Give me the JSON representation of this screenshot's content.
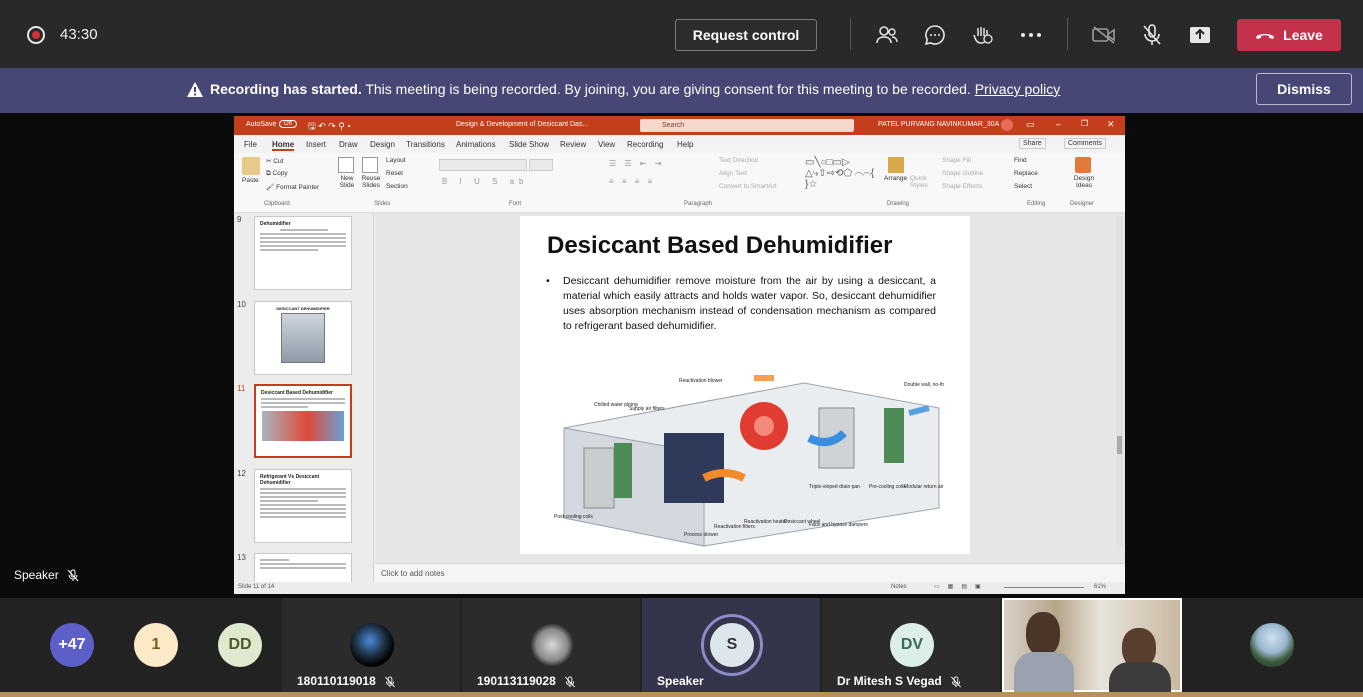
{
  "topbar": {
    "timer": "43:30",
    "request_control": "Request control",
    "leave": "Leave"
  },
  "banner": {
    "bold": "Recording has started.",
    "text": " This meeting is being recorded. By joining, you are giving consent for this meeting to be recorded. ",
    "link": "Privacy policy",
    "dismiss": "Dismiss"
  },
  "ppt": {
    "autosave": "AutoSave",
    "autosave_state": "Off",
    "doc_title": "Design & Development of Desiccant  Das...",
    "search": "Search",
    "user": "PATEL PURVANG NAVINKUMAR_30A",
    "tabs": [
      "File",
      "Home",
      "Insert",
      "Draw",
      "Design",
      "Transitions",
      "Animations",
      "Slide Show",
      "Review",
      "View",
      "Recording",
      "Help"
    ],
    "share": "Share",
    "comments": "Comments",
    "ribbon": {
      "paste": "Paste",
      "cut": "Cut",
      "copy": "Copy",
      "format_painter": "Format Painter",
      "new_slide": "New Slide",
      "reuse_slides": "Reuse Slides",
      "layout": "Layout",
      "reset": "Reset",
      "section": "Section",
      "text_direction": "Text Direction",
      "align_text": "Align Text",
      "convert_smartart": "Convert to SmartArt",
      "arrange": "Arrange",
      "quick_styles": "Quick Styles",
      "shape_fill": "Shape Fill",
      "shape_outline": "Shape Outline",
      "shape_effects": "Shape Effects",
      "find": "Find",
      "replace": "Replace",
      "select": "Select",
      "design_ideas": "Design Ideas",
      "groups": [
        "Clipboard",
        "Slides",
        "Font",
        "Paragraph",
        "Drawing",
        "Editing",
        "Designer"
      ]
    },
    "thumbs": [
      {
        "num": "9",
        "title": "Dehumidifier"
      },
      {
        "num": "10",
        "title": "DESICCANT DEHUMIDIFIER"
      },
      {
        "num": "11",
        "title": "Desiccant Based Dehumidifier"
      },
      {
        "num": "12",
        "title": "Refrigerant Vs Desiccant Dehumidifier"
      },
      {
        "num": "13",
        "title": ""
      }
    ],
    "slide": {
      "title": "Desiccant Based Dehumidifier",
      "bullet": "Desiccant dehumidifier remove moisture from the air by using a desiccant, a material which easily attracts and holds water vapor.  So, desiccant dehumidifier uses absorption mechanism instead of condensation mechanism as compared to refrigerant based dehumidifier."
    },
    "notes_placeholder": "Click to add notes",
    "status_slide": "Slide 11 of 14",
    "status_notes": "Notes",
    "zoom": "61%"
  },
  "speaker_label": "Speaker",
  "gallery": {
    "overflow": "+47",
    "p1_initial": "1",
    "p2_initials": "DD",
    "p3_name": "180110119018",
    "p4_name": "190113119028",
    "p5_initial": "S",
    "p5_name": "Speaker",
    "p6_initials": "DV",
    "p6_name": "Dr Mitesh S Vegad"
  },
  "colors": {
    "topbar": "#292929",
    "banner": "#464775",
    "leave": "#c4314b",
    "ppt_accent": "#c43e1c",
    "avatar_purple": "#5b5fc7"
  }
}
